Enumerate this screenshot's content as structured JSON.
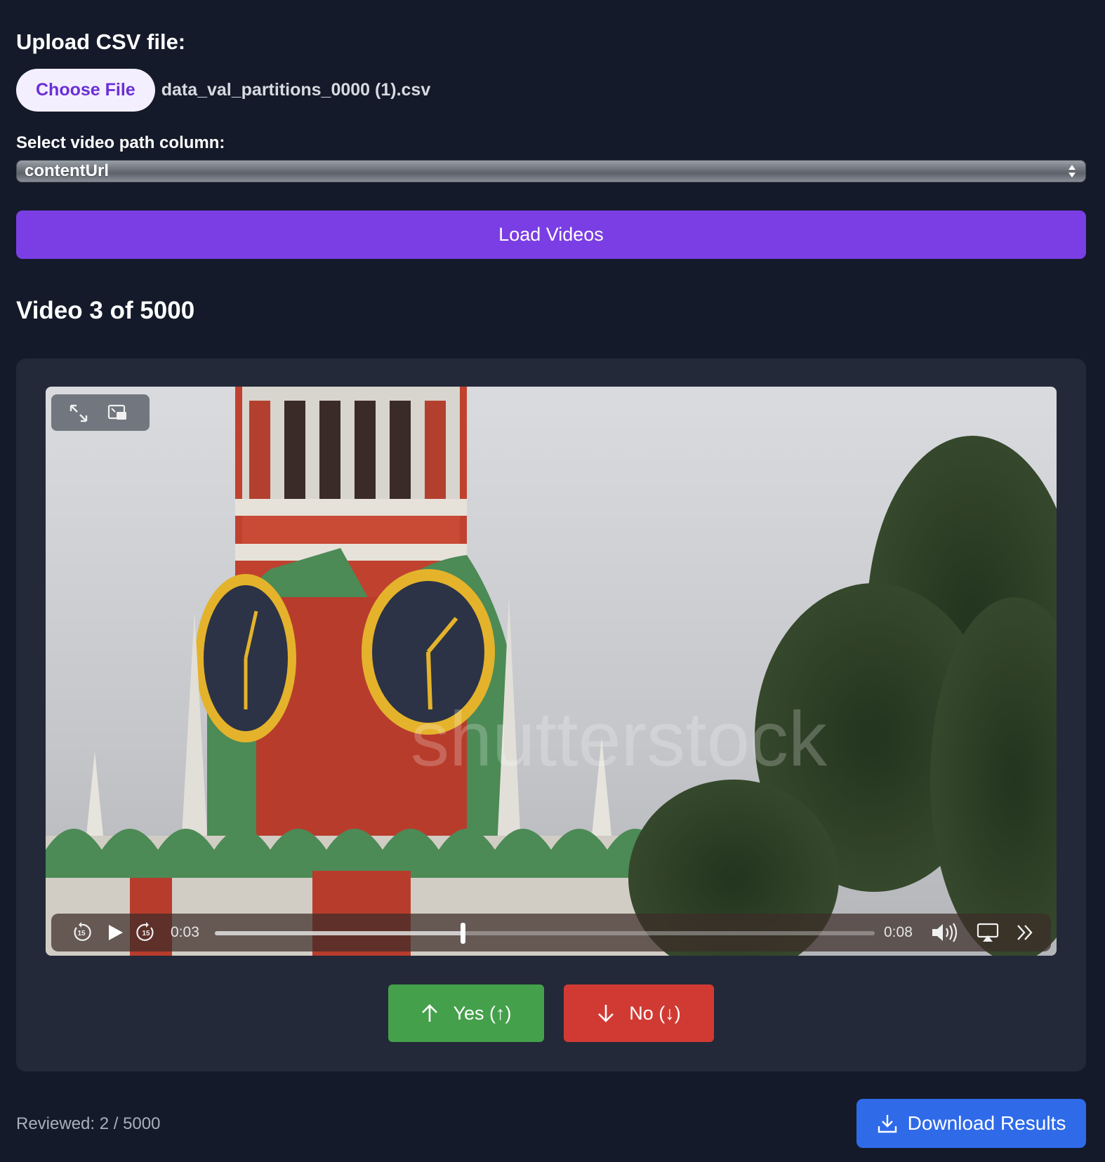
{
  "upload": {
    "label": "Upload CSV file:",
    "choose_button": "Choose File",
    "file_name": "data_val_partitions_0000 (1).csv"
  },
  "column_select": {
    "label": "Select video path column:",
    "selected": "contentUrl"
  },
  "load_button": "Load Videos",
  "video": {
    "title": "Video 3 of 5000",
    "current_time": "0:03",
    "duration": "0:08",
    "progress": 0.375,
    "skip_back_seconds": "15",
    "skip_forward_seconds": "15",
    "watermark": "shutterstock",
    "icons": {
      "fullscreen": "fullscreen-icon",
      "pip": "picture-in-picture-icon",
      "skip_back": "skip-back-15-icon",
      "play": "play-icon",
      "skip_forward": "skip-forward-15-icon",
      "volume": "volume-icon",
      "airplay": "airplay-icon",
      "more": "more-chevrons-icon"
    }
  },
  "vote": {
    "yes_label": "Yes (↑)",
    "no_label": "No (↓)",
    "yes_color": "#44a04b",
    "no_color": "#d13a33"
  },
  "footer": {
    "reviewed": "Reviewed: 2 / 5000",
    "download_button": "Download Results"
  },
  "colors": {
    "background": "#141a29",
    "panel": "#232938",
    "accent_purple": "#7a3ee4",
    "download_blue": "#2f6ae8"
  }
}
